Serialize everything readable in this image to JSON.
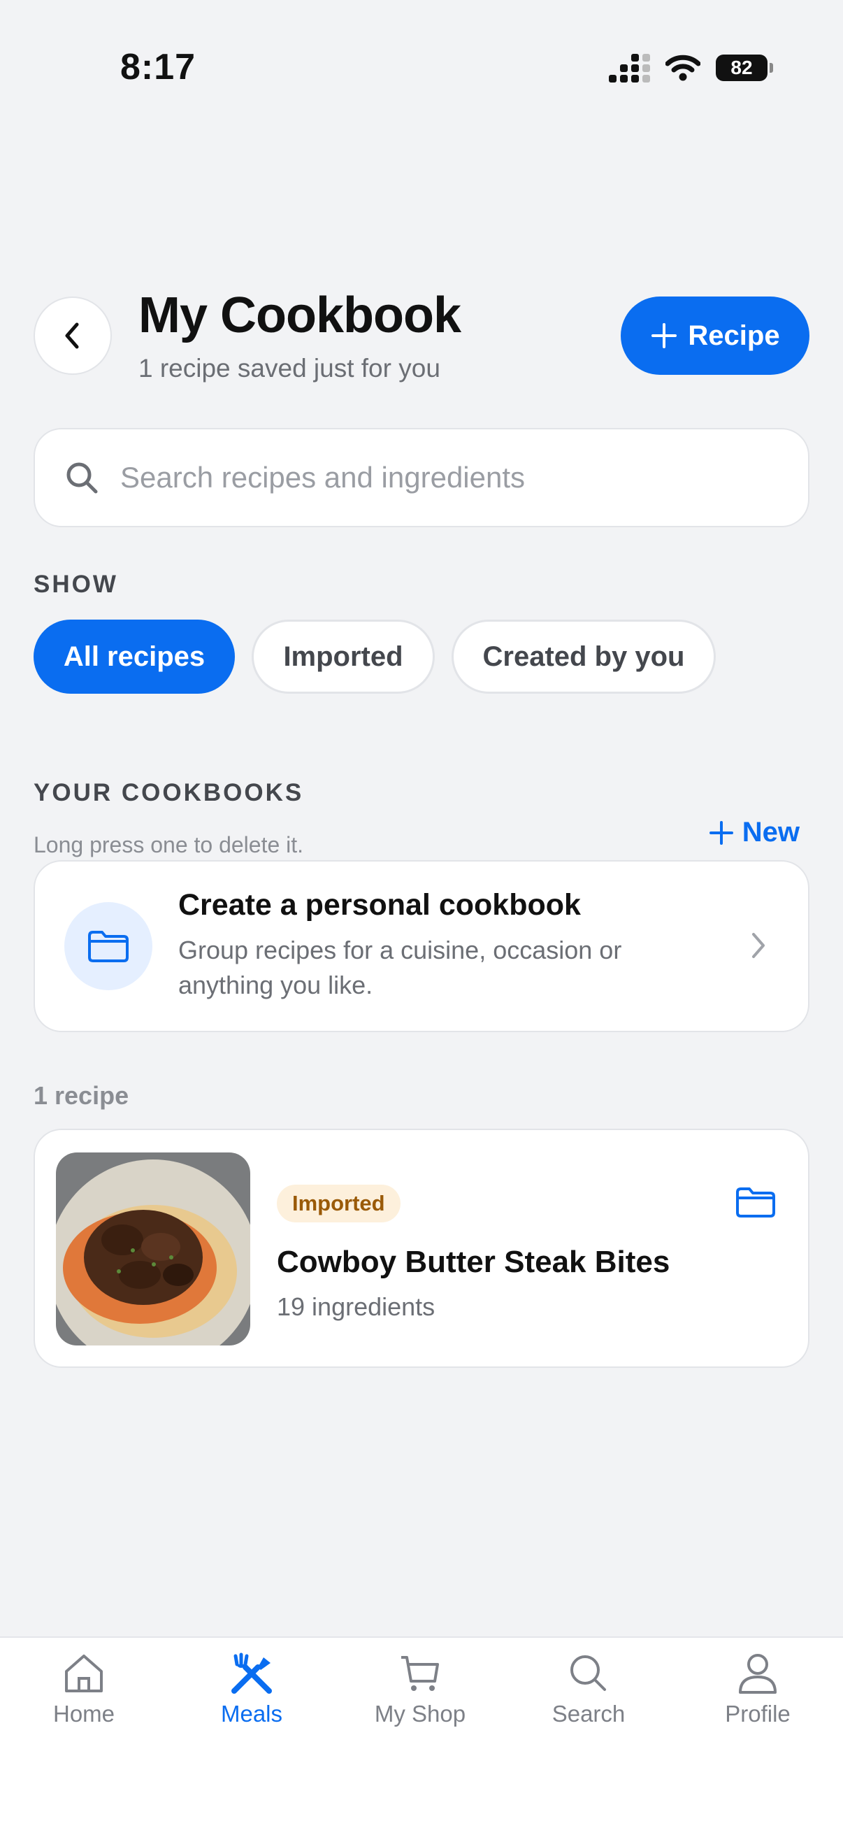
{
  "status_bar": {
    "time": "8:17",
    "battery": "82"
  },
  "header": {
    "title": "My Cookbook",
    "subtitle": "1 recipe saved just for you",
    "add_button_label": "Recipe"
  },
  "search": {
    "placeholder": "Search recipes and ingredients"
  },
  "filters": {
    "label": "SHOW",
    "chips": [
      {
        "label": "All recipes",
        "selected": true
      },
      {
        "label": "Imported",
        "selected": false
      },
      {
        "label": "Created by you",
        "selected": false
      }
    ]
  },
  "cookbooks": {
    "label": "YOUR COOKBOOKS",
    "hint": "Long press one to delete it.",
    "new_label": "New",
    "create_card": {
      "title": "Create a personal cookbook",
      "description": "Group recipes for a cuisine, occasion or anything you like."
    }
  },
  "recipes": {
    "count_label": "1 recipe",
    "items": [
      {
        "badge": "Imported",
        "title": "Cowboy Butter Steak Bites",
        "subtitle": "19 ingredients"
      }
    ]
  },
  "tabbar": {
    "items": [
      {
        "label": "Home",
        "icon": "home-icon",
        "active": false
      },
      {
        "label": "Meals",
        "icon": "utensils-icon",
        "active": true
      },
      {
        "label": "My Shop",
        "icon": "cart-icon",
        "active": false
      },
      {
        "label": "Search",
        "icon": "search-icon",
        "active": false
      },
      {
        "label": "Profile",
        "icon": "person-icon",
        "active": false
      }
    ]
  },
  "colors": {
    "accent": "#0a6df0",
    "background": "#f2f3f5",
    "badge_bg": "#fdf0dc",
    "badge_text": "#9a5a08"
  }
}
